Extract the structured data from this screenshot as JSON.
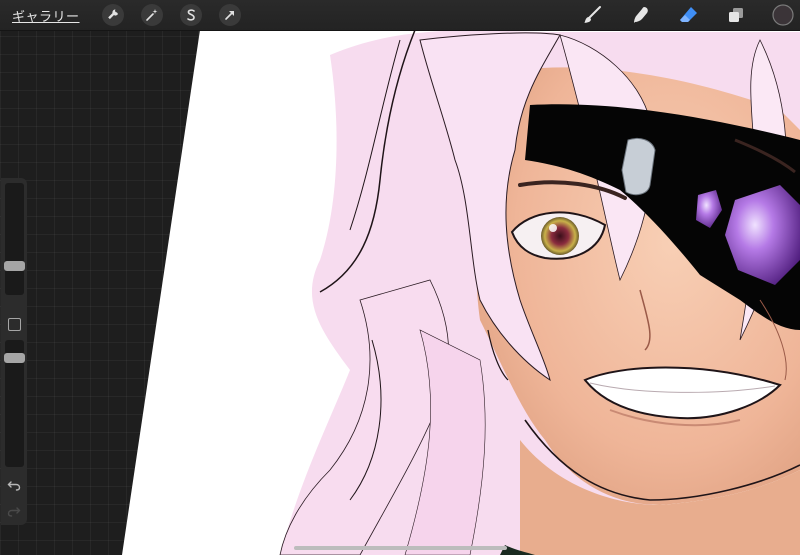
{
  "app": {
    "gallery_label": "ギャラリー"
  },
  "toolbar_left": [
    {
      "name": "actions",
      "icon": "wrench-icon"
    },
    {
      "name": "adjustments",
      "icon": "magic-wand-icon"
    },
    {
      "name": "selection",
      "icon": "selection-s-icon"
    },
    {
      "name": "transform",
      "icon": "transform-arrow-icon"
    }
  ],
  "toolbar_right": [
    {
      "name": "brush",
      "icon": "brush-icon",
      "active": false
    },
    {
      "name": "smudge",
      "icon": "smudge-finger-icon",
      "active": false
    },
    {
      "name": "eraser",
      "icon": "eraser-icon",
      "active": true
    },
    {
      "name": "layers",
      "icon": "layers-icon",
      "active": false
    },
    {
      "name": "color",
      "icon": "color-swatch",
      "color": "#3b3438"
    }
  ],
  "sidebar": {
    "brush_size_level": 0.15,
    "opacity_level": 0.1,
    "modify_icon": "square-modify-icon",
    "undo_icon": "undo-arrow-icon",
    "redo_icon": "redo-arrow-icon"
  },
  "colors": {
    "accent": "#3f8ef5",
    "canvas": "#ffffff",
    "hair": "#f6d6ee",
    "skin": "#f0b89c",
    "eyepatch": "#000000",
    "gem": "#8a3ccc"
  }
}
